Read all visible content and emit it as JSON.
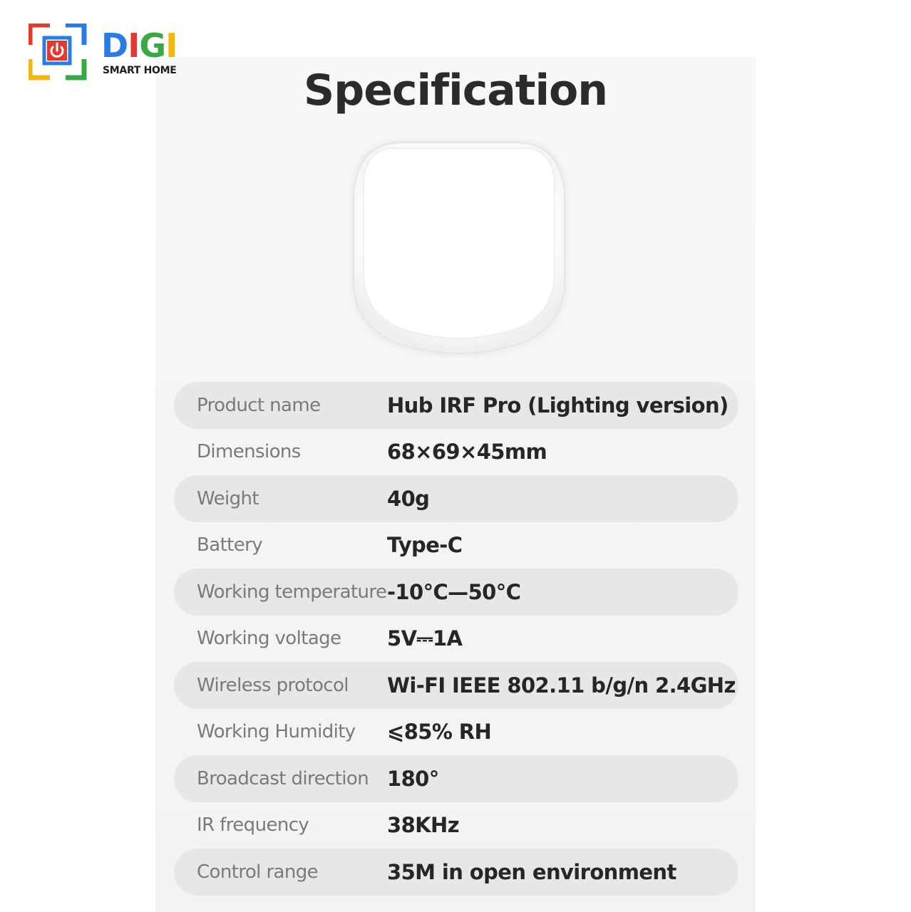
{
  "brand": {
    "name_parts": [
      "D",
      "I",
      "G",
      "I"
    ],
    "subtitle": "SMART HOME",
    "icon": "power-camera-logo-icon",
    "colors": {
      "blue": "#2a7be4",
      "red": "#e2392e",
      "green": "#3aa845",
      "yellow": "#f2b619"
    }
  },
  "title": "Specification",
  "product_image": "white-hub-device-image",
  "specs": [
    {
      "label": "Product name",
      "value": "Hub IRF Pro (Lighting version)"
    },
    {
      "label": "Dimensions",
      "value": "68×69×45mm"
    },
    {
      "label": "Weight",
      "value": "40g"
    },
    {
      "label": "Battery",
      "value": "Type-C"
    },
    {
      "label": "Working temperature",
      "value": "-10°C—50°C"
    },
    {
      "label": "Working voltage",
      "value": "5V⎓1A"
    },
    {
      "label": "Wireless protocol",
      "value": "Wi-FI IEEE 802.11 b/g/n 2.4GHz"
    },
    {
      "label": "Working Humidity",
      "value": "⩽85% RH"
    },
    {
      "label": "Broadcast direction",
      "value": "180°"
    },
    {
      "label": "IR frequency",
      "value": "38KHz"
    },
    {
      "label": "Control range",
      "value": "35M in open environment"
    }
  ]
}
